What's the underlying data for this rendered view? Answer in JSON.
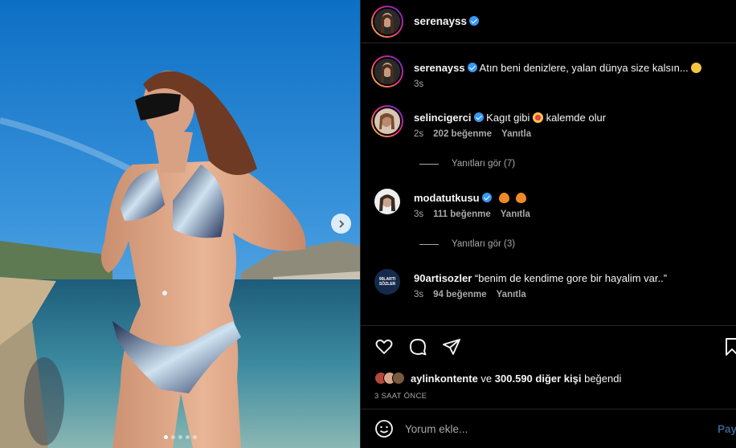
{
  "colors": {
    "accent": "#3897f0",
    "background": "#000000",
    "muted": "#a8a8a8",
    "text": "#f5f5f5"
  },
  "carousel": {
    "next_icon": "chevron-right-icon",
    "slide_count": 5,
    "active_slide": 1
  },
  "header": {
    "username": "serenayss"
  },
  "comments": [
    {
      "username": "serenayss",
      "text": "Atın beni denizlere, yalan dünya size kalsın...",
      "emoji": "grinning-face-icon",
      "time": "3s"
    },
    {
      "username": "selincigerci",
      "text_before": "Kagıt gibi",
      "emoji": "heart-eyes-icon",
      "text_after": "kalemde olur",
      "time": "2s",
      "likes": "202 beğenme",
      "reply": "Yanıtla",
      "view_replies": "Yanıtları gör (7)"
    },
    {
      "username": "modatutkusu",
      "emoji": "fire-icon",
      "time": "3s",
      "likes": "111 beğenme",
      "reply": "Yanıtla",
      "view_replies": "Yanıtları gör (3)"
    },
    {
      "username": "90artisozler",
      "text": "“benim de kendime gore bir hayalim var..”",
      "time": "3s",
      "likes": "94 beğenme",
      "reply": "Yanıtla",
      "avatar_text": "90LARTI SÖZLER"
    }
  ],
  "actions": {
    "icons": [
      "heart-icon",
      "comment-icon",
      "share-icon",
      "bookmark-icon"
    ]
  },
  "likes": {
    "user": "aylinkontente",
    "connector": "ve",
    "count": "300.590 diğer kişi",
    "suffix": "beğendi"
  },
  "timestamp": "3 SAAT ÖNCE",
  "comment_box": {
    "placeholder": "Yorum ekle...",
    "post_label": "Paylaş",
    "emoji_icon": "smiley-icon"
  }
}
